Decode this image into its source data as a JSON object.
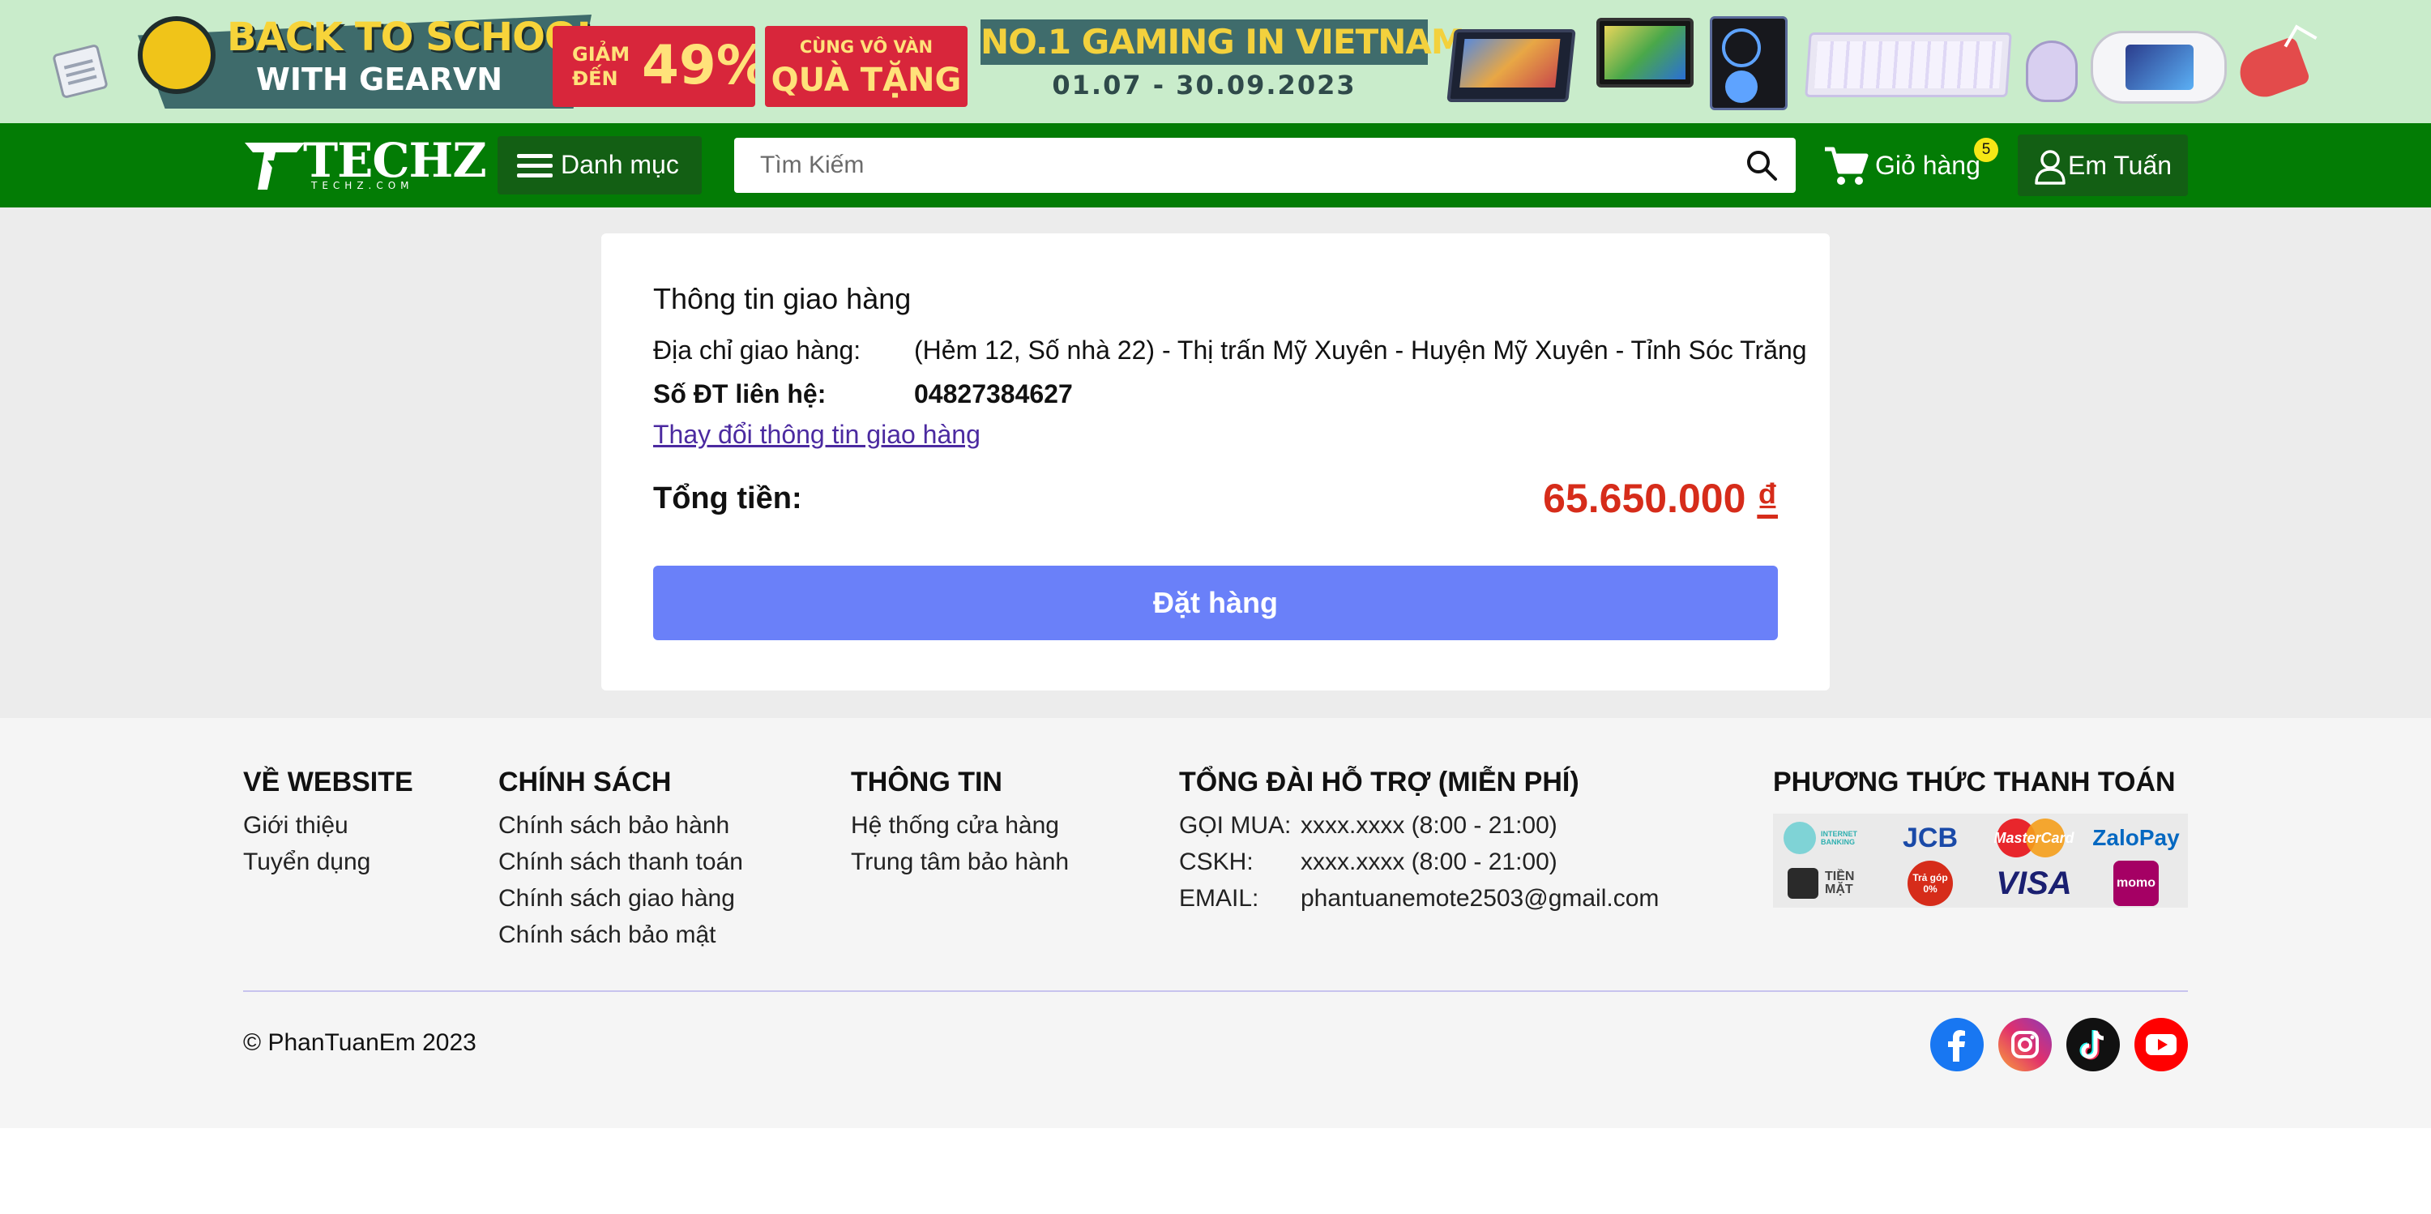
{
  "promo_banner": {
    "headline": "BACK TO SCHOOL",
    "subheadline": "WITH GEARVN",
    "discount_prefix": "GIẢM ĐẾN",
    "discount_value": "49%",
    "gift_prefix": "CÙNG VÔ VÀN",
    "gift_text": "QUÀ TẶNG",
    "tagline": "NO.1 GAMING IN VIETNAM",
    "date_range": "01.07 - 30.09.2023"
  },
  "header": {
    "logo_text": "TECHZ",
    "logo_sub": "TECHZ.COM",
    "menu_label": "Danh mục",
    "search_placeholder": "Tìm Kiếm",
    "search_value": "",
    "cart_label": "Giỏ hàng",
    "cart_count": "5",
    "user_name": "Em Tuấn"
  },
  "shipping": {
    "title": "Thông tin giao hàng",
    "address_label": "Địa chỉ giao hàng:",
    "address_value": "(Hẻm 12, Số nhà 22) - Thị trấn Mỹ Xuyên - Huyện Mỹ Xuyên - Tỉnh Sóc Trăng",
    "phone_label": "Số ĐT liên hệ:",
    "phone_value": "04827384627",
    "change_link": "Thay đổi thông tin giao hàng",
    "total_label": "Tổng tiền:",
    "total_amount": "65.650.000",
    "currency": "₫",
    "order_button": "Đặt hàng"
  },
  "footer": {
    "about": {
      "heading": "VỀ WEBSITE",
      "links": [
        "Giới thiệu",
        "Tuyển dụng"
      ]
    },
    "policy": {
      "heading": "CHÍNH SÁCH",
      "links": [
        "Chính sách bảo hành",
        "Chính sách thanh toán",
        "Chính sách giao hàng",
        "Chính sách bảo mật"
      ]
    },
    "info": {
      "heading": "THÔNG TIN",
      "links": [
        "Hệ thống cửa hàng",
        "Trung tâm bảo hành"
      ]
    },
    "support": {
      "heading": "TỔNG ĐÀI HỖ TRỢ (MIỄN PHÍ)",
      "rows": [
        {
          "key": "GỌI MUA:",
          "value": "xxxx.xxxx (8:00 - 21:00)"
        },
        {
          "key": "CSKH:",
          "value": "xxxx.xxxx (8:00 - 21:00)"
        },
        {
          "key": "EMAIL:",
          "value": "phantuanemote2503@gmail.com"
        }
      ]
    },
    "payment": {
      "heading": "PHƯƠNG THỨC THANH TOÁN",
      "methods": [
        "INTERNET BANKING",
        "JCB",
        "MasterCard",
        "ZaloPay",
        "TIỀN MẶT",
        "Trả góp 0%",
        "VISA",
        "momo"
      ]
    },
    "copyright": "© PhanTuanEm 2023",
    "socials": [
      "facebook-icon",
      "instagram-icon",
      "tiktok-icon",
      "youtube-icon"
    ]
  },
  "colors": {
    "header_green": "#037c05",
    "banner_green": "#c9eccb",
    "order_button": "#6a80f9",
    "total_red": "#d62c1a",
    "link_purple": "#4b2aa0"
  }
}
